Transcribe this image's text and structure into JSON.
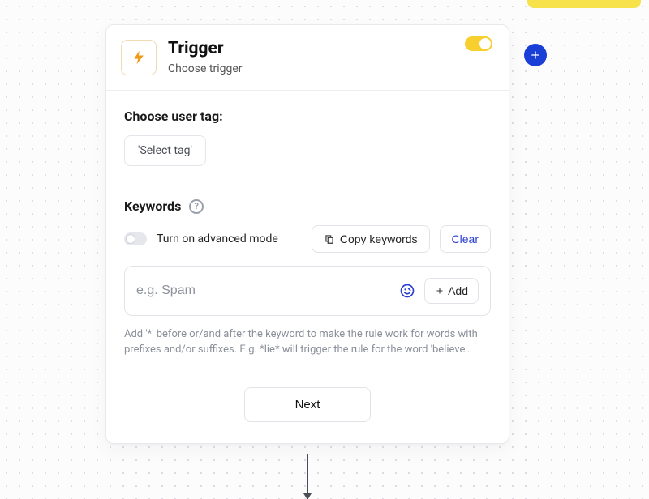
{
  "header": {
    "title": "Trigger",
    "subtitle": "Choose trigger"
  },
  "tag_section": {
    "label": "Choose user tag:",
    "select_value": "'Select tag'"
  },
  "keywords_section": {
    "label": "Keywords",
    "advanced_label": "Turn on advanced mode",
    "copy_label": "Copy keywords",
    "clear_label": "Clear",
    "input_placeholder": "e.g. Spam",
    "add_label": "Add",
    "hint": "Add '*' before or/and after the keyword to make the rule work for words with prefixes and/or suffixes. E.g. *lie* will trigger the rule for the word 'believe'."
  },
  "footer": {
    "next_label": "Next"
  }
}
